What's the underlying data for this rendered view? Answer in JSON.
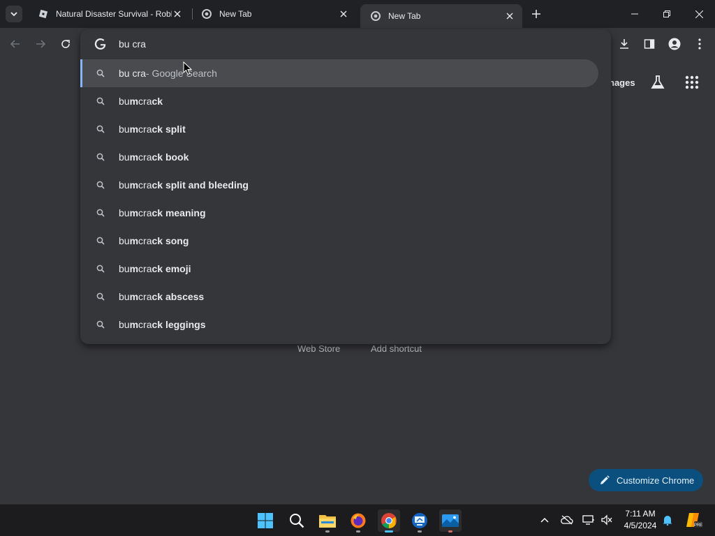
{
  "tabs": [
    {
      "title": "Natural Disaster Survival - Robl",
      "favicon": "roblox-icon",
      "active": false
    },
    {
      "title": "New Tab",
      "favicon": "chrome-icon",
      "active": false
    },
    {
      "title": "New Tab",
      "favicon": "chrome-icon",
      "active": true
    }
  ],
  "omnibox": {
    "query": "bu cra",
    "top_suggestion": {
      "query": "bu cra",
      "suffix": " - Google Search"
    },
    "suggestions": [
      {
        "prefix": "bu",
        "mid": "m",
        "mid2": " cra",
        "rest": "ck"
      },
      {
        "prefix": "bu",
        "mid": "m",
        "mid2": " cra",
        "rest": "ck split"
      },
      {
        "prefix": "bu",
        "mid": "m",
        "mid2": " cra",
        "rest": "ck book"
      },
      {
        "prefix": "bu",
        "mid": "m",
        "mid2": " cra",
        "rest": "ck split and bleeding"
      },
      {
        "prefix": "bu",
        "mid": "m",
        "mid2": " cra",
        "rest": "ck meaning"
      },
      {
        "prefix": "bu",
        "mid": "m",
        "mid2": " cra",
        "rest": "ck song"
      },
      {
        "prefix": "bu",
        "mid": "m",
        "mid2": " cra",
        "rest": "ck emoji"
      },
      {
        "prefix": "bu",
        "mid": "m",
        "mid2": " cra",
        "rest": "ck abscess"
      },
      {
        "prefix": "bu",
        "mid": "m",
        "mid2": " cra",
        "rest": "ck leggings"
      }
    ]
  },
  "page": {
    "images_link": "nages",
    "shortcuts": [
      "Web Store",
      "Add shortcut"
    ],
    "customize_label": "Customize Chrome"
  },
  "taskbar": {
    "apps": [
      "start-icon",
      "search-icon",
      "file-explorer-icon",
      "firefox-icon",
      "chrome-icon",
      "remote-desktop-icon",
      "photos-icon"
    ],
    "time": "7:11 AM",
    "date": "4/5/2024"
  },
  "colors": {
    "accent": "#8ab4f8",
    "customize_bg": "#0b4f7e",
    "taskbar_indicator": "#4cc2ff"
  }
}
